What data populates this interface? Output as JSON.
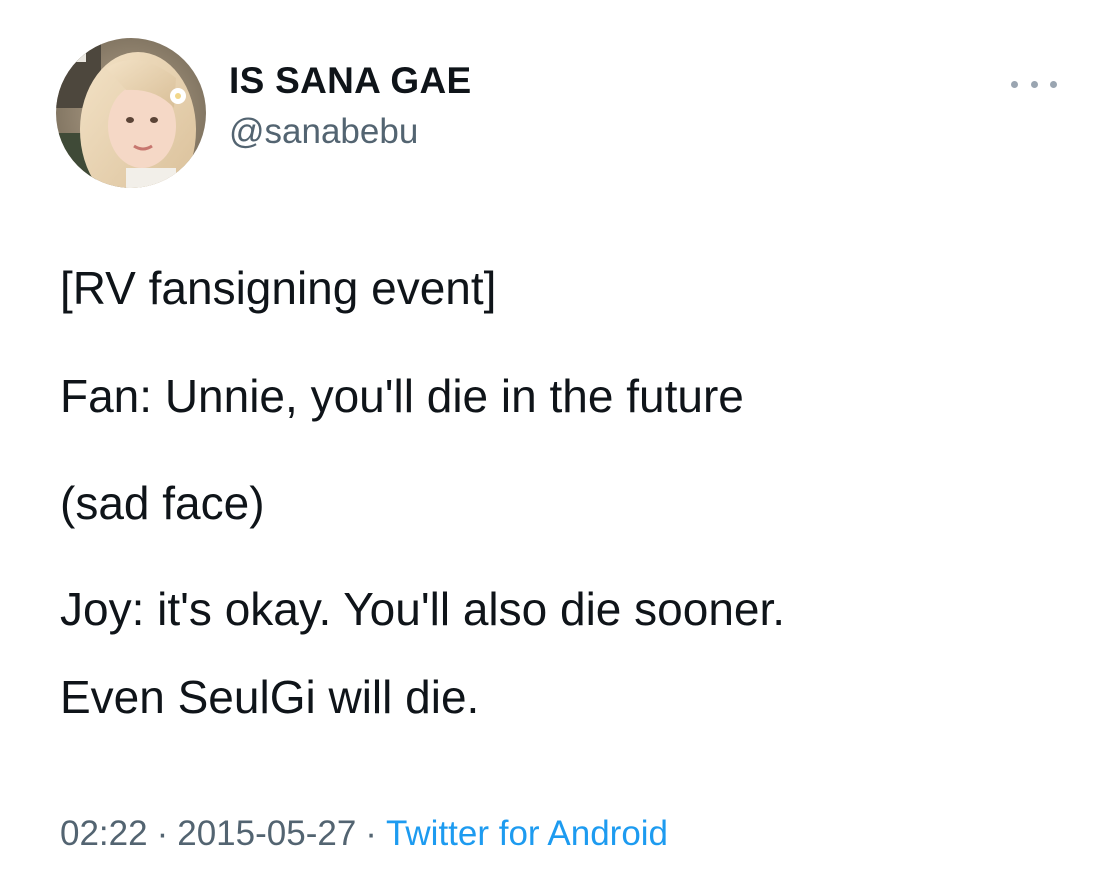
{
  "user": {
    "display_name": "IS SANA GAE",
    "handle": "@sanabebu"
  },
  "tweet": {
    "lines": [
      "[RV fansigning event]",
      "Fan: Unnie, you'll die in the future",
      "(sad face)",
      "Joy: it's okay. You'll also die sooner.",
      "Even SeulGi will die."
    ]
  },
  "meta": {
    "time": "02:22",
    "separator": "·",
    "date": "2015-05-27",
    "source": "Twitter for Android"
  },
  "icons": {
    "more": "more-horizontal-icon",
    "avatar": "profile-avatar"
  },
  "colors": {
    "text": "#0f1419",
    "secondary": "#536471",
    "link": "#1d9bf0",
    "background": "#ffffff"
  }
}
